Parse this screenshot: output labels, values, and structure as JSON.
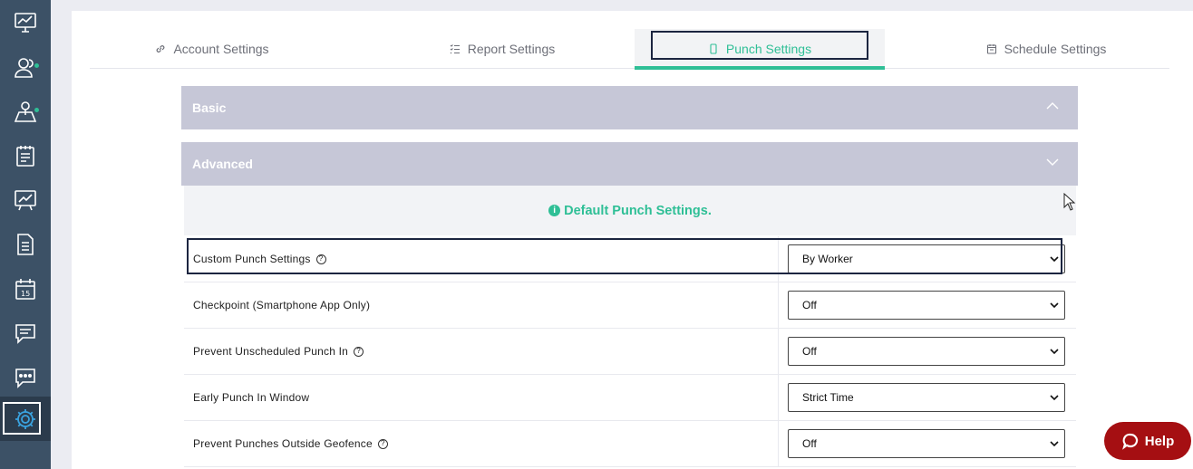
{
  "tabs": [
    {
      "label": "Account Settings",
      "icon": "link-icon"
    },
    {
      "label": "Report Settings",
      "icon": "checklist-icon"
    },
    {
      "label": "Punch Settings",
      "icon": "smartphone-icon"
    },
    {
      "label": "Schedule Settings",
      "icon": "calendar-icon"
    }
  ],
  "sections": {
    "basic": {
      "title": "Basic"
    },
    "advanced": {
      "title": "Advanced"
    }
  },
  "notice": "Default Punch Settings.",
  "settings": [
    {
      "label": "Custom Punch Settings",
      "value": "By Worker"
    },
    {
      "label": "Checkpoint (Smartphone App Only)",
      "value": "Off"
    },
    {
      "label": "Prevent Unscheduled Punch In",
      "value": "Off"
    },
    {
      "label": "Early Punch In Window",
      "value": "Strict Time"
    },
    {
      "label": "Prevent Punches Outside Geofence",
      "value": "Off"
    }
  ],
  "help_button": {
    "label": "Help"
  },
  "colors": {
    "accent": "#2fbf96",
    "sidebar": "#3c5166",
    "help": "#a50f12",
    "accordion": "#c6c7d7"
  }
}
